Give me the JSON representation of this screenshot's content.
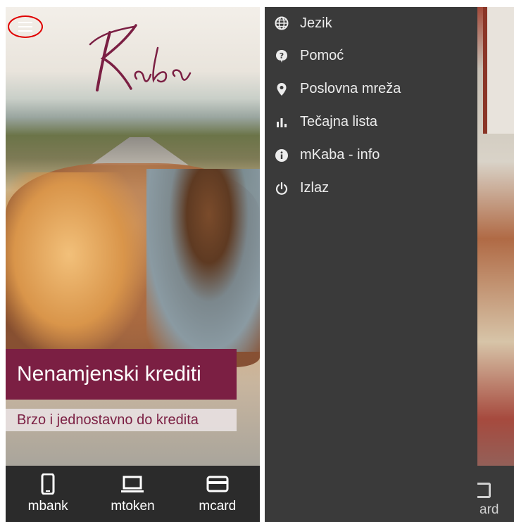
{
  "home": {
    "promo_title": "Nenamjenski krediti",
    "promo_subtitle": "Brzo i jednostavno do kredita",
    "bottom_nav": [
      {
        "label": "mbank",
        "icon": "phone-icon"
      },
      {
        "label": "mtoken",
        "icon": "laptop-icon"
      },
      {
        "label": "mcard",
        "icon": "credit-card-icon"
      }
    ],
    "menu_icon": "hamburger-menu-icon",
    "logo_text": "Kaba",
    "colors": {
      "brand": "#7b1f43",
      "bottom_bar": "#2b2b2b",
      "highlight": "#e00000"
    }
  },
  "drawer": {
    "items": [
      {
        "label": "Jezik",
        "icon": "globe-icon"
      },
      {
        "label": "Pomoć",
        "icon": "help-icon"
      },
      {
        "label": "Poslovna mreža",
        "icon": "location-pin-icon"
      },
      {
        "label": "Tečajna lista",
        "icon": "bar-chart-icon"
      },
      {
        "label": "mKaba - info",
        "icon": "info-icon"
      },
      {
        "label": "Izlaz",
        "icon": "power-icon"
      }
    ],
    "background_label": "ard",
    "colors": {
      "drawer_bg": "#3a3a3a",
      "text": "#ececec"
    }
  }
}
